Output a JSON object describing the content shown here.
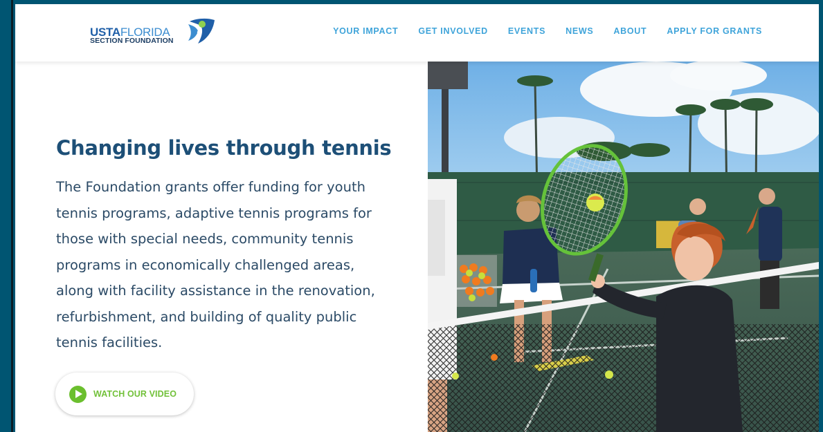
{
  "logo": {
    "line1_a": "USTA",
    "line1_b": "FLORIDA",
    "line2": "SECTION FOUNDATION",
    "mark_icon": "tennis-player-mark-icon"
  },
  "nav": {
    "items": [
      {
        "label": "YOUR IMPACT"
      },
      {
        "label": "GET INVOLVED"
      },
      {
        "label": "EVENTS"
      },
      {
        "label": "NEWS"
      },
      {
        "label": "ABOUT"
      },
      {
        "label": "APPLY FOR GRANTS"
      }
    ]
  },
  "hero": {
    "title": "Changing lives through tennis",
    "body": "The Foundation grants offer funding for youth tennis programs, adaptive tennis programs for those with special needs, community tennis programs in economically challenged areas, along with facility assistance in the renovation, refurbishment, and building of quality public tennis facilities.",
    "video_button_label": "WATCH OUR VIDEO",
    "video_icon": "play-circle-icon"
  },
  "colors": {
    "frame": "#005572",
    "nav_text": "#3fa4da",
    "headline": "#1d4f77",
    "body_text": "#2b4a66",
    "accent_green": "#6bbf2e"
  }
}
